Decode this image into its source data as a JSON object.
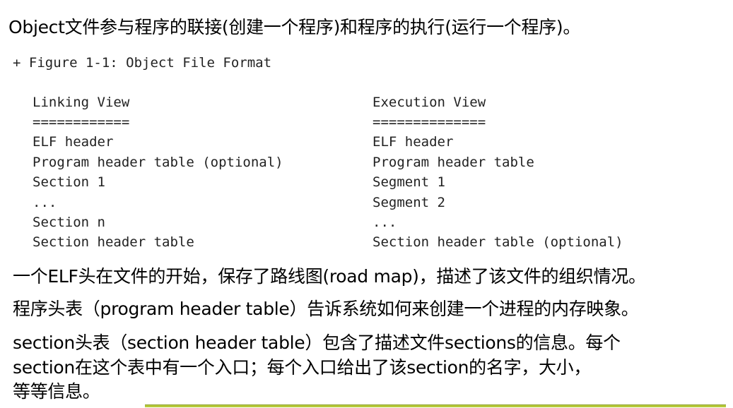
{
  "intro": "Object文件参与程序的联接(创建一个程序)和程序的执行(运行一个程序)。",
  "figure": {
    "title": "+ Figure 1-1: Object File Format",
    "linking": {
      "heading": "Linking View",
      "underline": "============",
      "rows": [
        "ELF header",
        "Program header table (optional)",
        "Section 1",
        "...",
        "Section n",
        "Section header table"
      ]
    },
    "execution": {
      "heading": "Execution View",
      "underline": "==============",
      "rows": [
        "ELF header",
        "Program header table",
        "Segment 1",
        "Segment 2",
        "...",
        "Section header table (optional)"
      ]
    }
  },
  "paragraphs": {
    "p1": "一个ELF头在文件的开始，保存了路线图(road map)，描述了该文件的组织情况。",
    "p2": "程序头表（program header table）告诉系统如何来创建一个进程的内存映象。",
    "p3_line1": "section头表（section header table）包含了描述文件sections的信息。每个",
    "p3_line2": "section在这个表中有一个入口；每个入口给出了该section的名字，大小，",
    "p3_line3": "等等信息。"
  },
  "colors": {
    "rule": "#b7c93a"
  }
}
